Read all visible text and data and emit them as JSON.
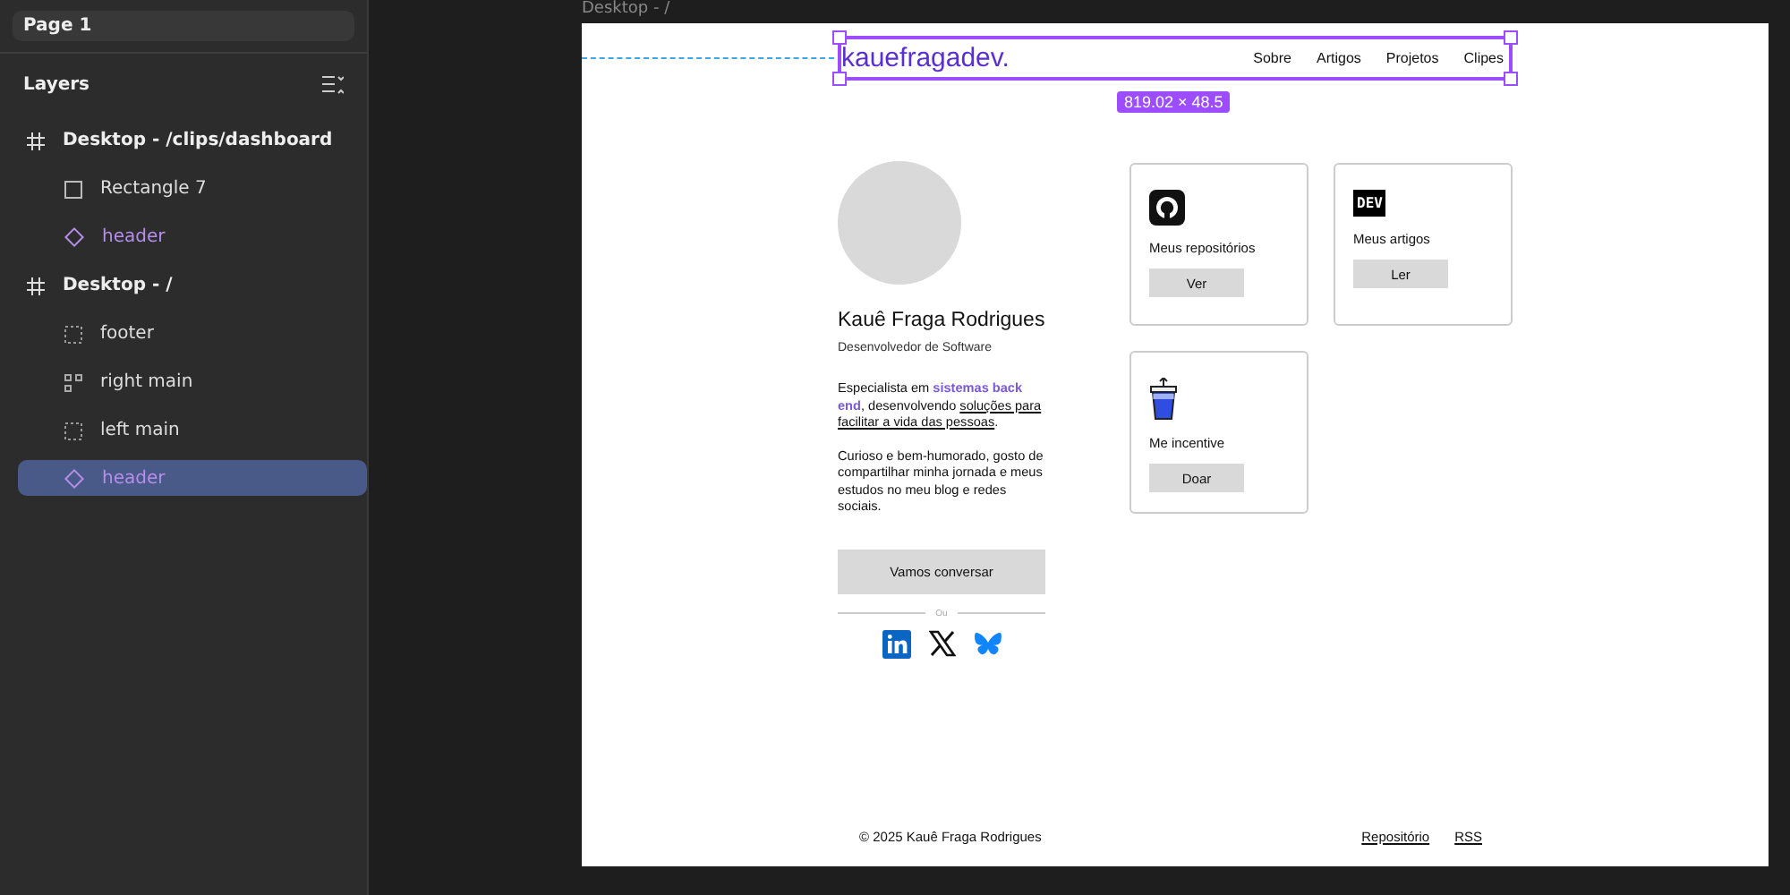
{
  "sidebar": {
    "page": "Page 1",
    "layers_title": "Layers",
    "layers": [
      {
        "label": "Desktop - /clips/dashboard",
        "kind": "frame",
        "selected": false,
        "children": [
          {
            "label": "Rectangle 7",
            "kind": "rectangle",
            "selected": false
          },
          {
            "label": "header",
            "kind": "component",
            "selected": false
          }
        ]
      },
      {
        "label": "Desktop - /",
        "kind": "frame",
        "selected": false,
        "children": [
          {
            "label": "footer",
            "kind": "section",
            "selected": false
          },
          {
            "label": "right main",
            "kind": "grid",
            "selected": false
          },
          {
            "label": "left main",
            "kind": "section",
            "selected": false
          },
          {
            "label": "header",
            "kind": "component",
            "selected": true
          }
        ]
      }
    ]
  },
  "canvas": {
    "frame_label": "Desktop - /",
    "selection_size": "819.02 × 48.5",
    "site": {
      "logo": "kauefragadev.",
      "nav": [
        "Sobre",
        "Artigos",
        "Projetos",
        "Clipes"
      ],
      "name": "Kauê Fraga Rodrigues",
      "role": "Desenvolvedor de Software",
      "bio": [
        [
          {
            "kind": "plain",
            "text": "Especialista em "
          },
          {
            "kind": "highlight",
            "text": "sistemas back end"
          },
          {
            "kind": "plain",
            "text": ", desenvolvendo "
          },
          {
            "kind": "underline",
            "text": "soluções para facilitar a vida das pessoas"
          },
          {
            "kind": "plain",
            "text": "."
          }
        ],
        [
          {
            "kind": "plain",
            "text": "Curioso e bem-humorado, gosto de compartilhar minha jornada e meus estudos no meu blog e redes sociais."
          }
        ]
      ],
      "cta": "Vamos conversar",
      "divider_text": "Ou",
      "socials": [
        {
          "kind": "linkedin"
        },
        {
          "kind": "x"
        },
        {
          "kind": "bluesky"
        }
      ],
      "cards": [
        {
          "kind": "github",
          "title": "Meus repositórios",
          "button": "Ver"
        },
        {
          "kind": "dev",
          "badge": "DEV",
          "title": "Meus artigos",
          "button": "Ler"
        },
        {
          "kind": "cup",
          "title": "Me incentive",
          "button": "Doar"
        }
      ],
      "footer": {
        "copyright": "© 2025 Kauê Fraga Rodrigues",
        "links": [
          "Repositório",
          "RSS"
        ]
      }
    }
  }
}
